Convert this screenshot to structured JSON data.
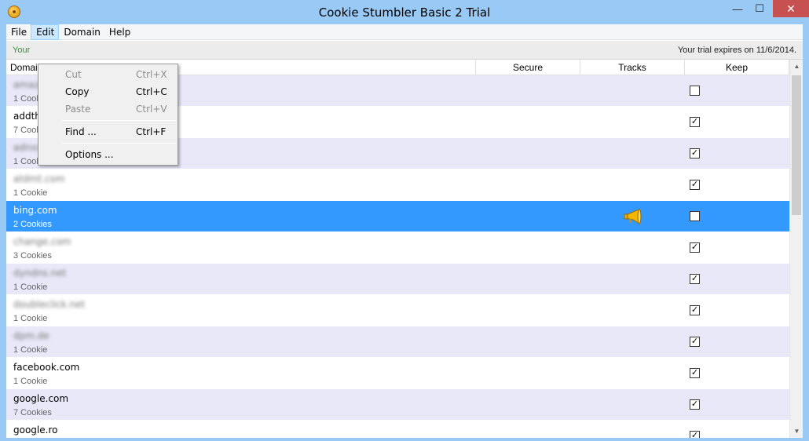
{
  "window": {
    "title": "Cookie Stumbler Basic 2 Trial",
    "minimize": "—",
    "maximize": "☐",
    "close": "✕"
  },
  "menubar": {
    "file": "File",
    "edit": "Edit",
    "domain": "Domain",
    "help": "Help"
  },
  "trial": {
    "left": "Your",
    "right": "Your trial expires on 11/6/2014."
  },
  "columns": {
    "domain": "Domain",
    "secure": "Secure",
    "tracks": "Tracks",
    "keep": "Keep"
  },
  "rows": [
    {
      "domain": "amazon.com",
      "count": "1 Cookie",
      "keep": false,
      "blurred": true
    },
    {
      "domain": "addthis.com",
      "count": "7 Cookies",
      "keep": true,
      "blurred": false
    },
    {
      "domain": "adnxs.com",
      "count": "1 Cookie",
      "keep": true,
      "blurred": true
    },
    {
      "domain": "atdmt.com",
      "count": "1 Cookie",
      "keep": true,
      "blurred": true
    },
    {
      "domain": "bing.com",
      "count": "2 Cookies",
      "keep": false,
      "blurred": false,
      "tracks": true,
      "selected": true
    },
    {
      "domain": "change.com",
      "count": "3 Cookies",
      "keep": true,
      "blurred": true
    },
    {
      "domain": "dyndns.net",
      "count": "1 Cookie",
      "keep": true,
      "blurred": true
    },
    {
      "domain": "doubleclick.net",
      "count": "1 Cookie",
      "keep": true,
      "blurred": true
    },
    {
      "domain": "dpm.de",
      "count": "1 Cookie",
      "keep": true,
      "blurred": true
    },
    {
      "domain": "facebook.com",
      "count": "1 Cookie",
      "keep": true,
      "blurred": false
    },
    {
      "domain": "google.com",
      "count": "7 Cookies",
      "keep": true,
      "blurred": false
    },
    {
      "domain": "google.ro",
      "count": "",
      "keep": true,
      "blurred": false
    }
  ],
  "edit_menu": {
    "cut": {
      "label": "Cut",
      "shortcut": "Ctrl+X"
    },
    "copy": {
      "label": "Copy",
      "shortcut": "Ctrl+C"
    },
    "paste": {
      "label": "Paste",
      "shortcut": "Ctrl+V"
    },
    "find": {
      "label": "Find ...",
      "shortcut": "Ctrl+F"
    },
    "options": {
      "label": "Options ..."
    }
  },
  "checkmark": "✓",
  "colors": {
    "selected": "#3399ff",
    "alt_row": "#e8e8f8",
    "trial_green": "#2c9a2c",
    "title_bar": "#99c9f5",
    "close_button": "#c75050"
  }
}
